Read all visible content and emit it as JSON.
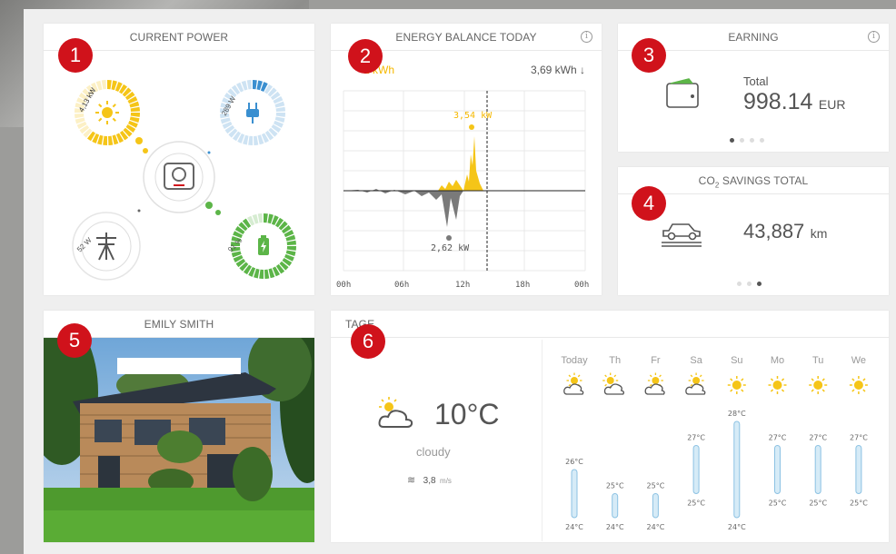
{
  "power": {
    "title": "CURRENT POWER",
    "badge": "1",
    "solar": {
      "label": "4,13 kW",
      "color": "#f5c518",
      "fraction": 0.62
    },
    "consumption": {
      "label": "289 W",
      "color": "#3a8fd0",
      "fraction": 0.08
    },
    "grid": {
      "label": "52 W",
      "color": "#666666"
    },
    "battery": {
      "label": "91 %",
      "color": "#5cb548",
      "fraction": 0.91
    }
  },
  "energy": {
    "title": "ENERGY BALANCE TODAY",
    "badge": "2",
    "left_value": "1 kWh",
    "right_value": "3,69 kWh ↓",
    "peak_label": "3,54 kW",
    "low_label": "2,62 kW",
    "x_ticks": [
      "00h",
      "06h",
      "12h",
      "18h",
      "00h"
    ]
  },
  "earning": {
    "title": "EARNING",
    "badge": "3",
    "total_label": "Total",
    "amount": "998.14",
    "unit": "EUR"
  },
  "co2": {
    "title_prefix": "CO",
    "title_sub": "2",
    "title_suffix": " SAVINGS TOTAL",
    "badge": "4",
    "value": "43,887",
    "unit": "km"
  },
  "house": {
    "title": "EMILY SMITH",
    "badge": "5"
  },
  "weather": {
    "title": "TAGE",
    "badge": "6",
    "temp": "10°C",
    "condition": "cloudy",
    "wind_value": "3,8",
    "wind_unit": "m/s",
    "days": [
      {
        "name": "Today",
        "icon": "sun-cloud-icon",
        "high": "26°C",
        "low": "24°C",
        "hi": 26,
        "lo": 24
      },
      {
        "name": "Th",
        "icon": "cloud-sun-icon",
        "high": "25°C",
        "low": "24°C",
        "hi": 25,
        "lo": 24
      },
      {
        "name": "Fr",
        "icon": "sun-cloud-icon",
        "high": "25°C",
        "low": "24°C",
        "hi": 25,
        "lo": 24
      },
      {
        "name": "Sa",
        "icon": "sun-cloud-icon",
        "high": "27°C",
        "low": "25°C",
        "hi": 27,
        "lo": 25
      },
      {
        "name": "Su",
        "icon": "sun-icon",
        "high": "28°C",
        "low": "24°C",
        "hi": 28,
        "lo": 24
      },
      {
        "name": "Mo",
        "icon": "sun-icon",
        "high": "27°C",
        "low": "25°C",
        "hi": 27,
        "lo": 25
      },
      {
        "name": "Tu",
        "icon": "sun-icon",
        "high": "27°C",
        "low": "25°C",
        "hi": 27,
        "lo": 25
      },
      {
        "name": "We",
        "icon": "sun-icon",
        "high": "27°C",
        "low": "25°C",
        "hi": 27,
        "lo": 25
      }
    ]
  }
}
